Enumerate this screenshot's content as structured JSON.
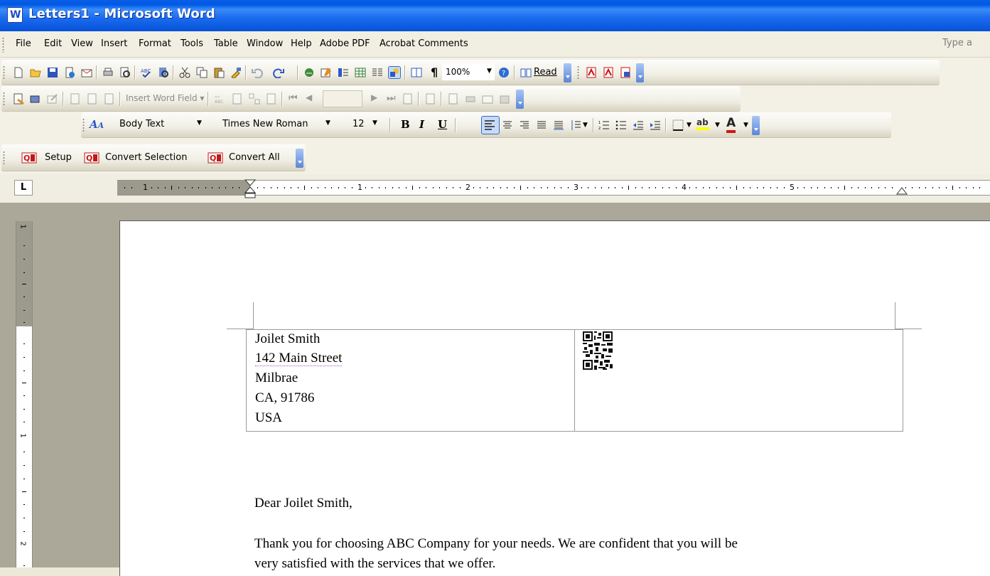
{
  "window": {
    "title": "Letters1 - Microsoft Word",
    "app_icon": "word-icon"
  },
  "menu": {
    "items": [
      "File",
      "Edit",
      "View",
      "Insert",
      "Format",
      "Tools",
      "Table",
      "Window",
      "Help",
      "Adobe PDF",
      "Acrobat Comments"
    ],
    "help_placeholder": "Type a"
  },
  "standard_toolbar": {
    "zoom": "100%",
    "read_label": "Read"
  },
  "mail_merge_toolbar": {
    "insert_word_field": "Insert Word Field ▾"
  },
  "formatting_toolbar": {
    "style": "Body Text",
    "font": "Times New Roman",
    "size": "12",
    "bold": "B",
    "italic": "I",
    "underline": "U",
    "font_color_letter": "A"
  },
  "qr_toolbar": {
    "setup": "Setup",
    "convert_selection": "Convert Selection",
    "convert_all": "Convert All"
  },
  "ruler": {
    "tab_selector": "L",
    "h_numbers": [
      "1",
      "1",
      "2",
      "3",
      "4",
      "5"
    ],
    "v_numbers": [
      "1",
      "1",
      "2"
    ]
  },
  "document": {
    "address": [
      "Joilet Smith",
      "142 Main Street",
      "Milbrae",
      "CA, 91786",
      "USA"
    ],
    "salutation": "Dear Joilet Smith,",
    "body_line1": "Thank you for choosing ABC Company for your needs. We are confident that you will be",
    "body_line2": "very satisfied with the services that we offer."
  },
  "colors": {
    "titlebar": "#0552d8",
    "toolbar_bg": "#f1efe4",
    "workspace_bg": "#aca899",
    "accent_red": "#d21414"
  }
}
